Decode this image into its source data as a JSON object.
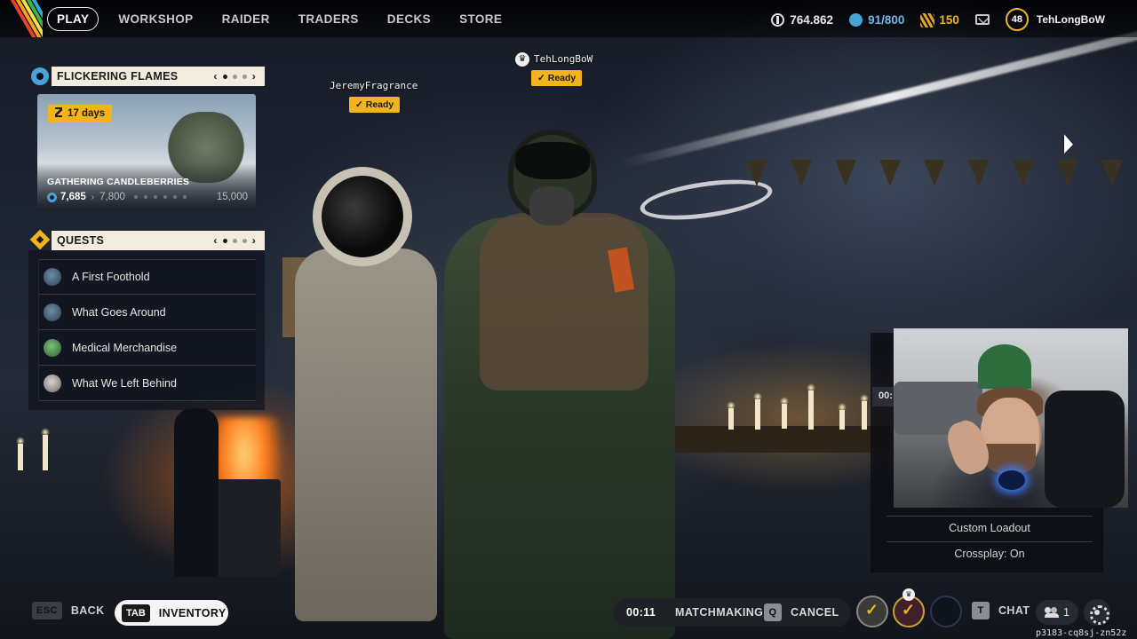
{
  "nav": {
    "items": [
      "PLAY",
      "WORKSHOP",
      "RAIDER",
      "TRADERS",
      "DECKS",
      "STORE"
    ]
  },
  "currencies": {
    "coins": "764.862",
    "stash": "91/800",
    "raider_tokens": "150",
    "level": "48",
    "username": "TehLongBoW"
  },
  "party": [
    {
      "name": "TehLongBoW",
      "status": "Ready",
      "leader": true
    },
    {
      "name": "JeremyFragrance",
      "status": "Ready",
      "leader": false
    }
  ],
  "event": {
    "header": "FLICKERING FLAMES",
    "days_left": "17  days",
    "title": "GATHERING CANDLEBERRIES",
    "current": "7,685",
    "next": "7,800",
    "max": "15,000"
  },
  "quests": {
    "header": "QUESTS",
    "items": [
      "A First Foothold",
      "What Goes Around",
      "Medical Merchandise",
      "What We Left Behind"
    ]
  },
  "right_panel": {
    "timer_peek": "00:",
    "custom_loadout": "Custom Loadout",
    "crossplay": "Crossplay: On"
  },
  "bottom": {
    "back_key": "ESC",
    "back_label": "BACK",
    "inventory_key": "TAB",
    "inventory_label": "INVENTORY",
    "matchmaking_time": "00:11",
    "matchmaking_label": "MATCHMAKING",
    "cancel_key": "Q",
    "cancel_label": "CANCEL",
    "chat_key": "T",
    "chat_label": "CHAT",
    "friends_count": "1"
  },
  "build_id": "p3183-cq8sj-zn52z",
  "colors": {
    "accent_yellow": "#f2b31b",
    "accent_blue": "#4aa3d8",
    "header_bg": "#f1ecdd"
  },
  "icons": [
    "coin-icon",
    "stash-icon",
    "raider-token-icon",
    "mail-icon",
    "gear-icon",
    "quest-icon",
    "hourglass-icon",
    "crown-icon",
    "check-icon",
    "people-icon",
    "settings-icon"
  ]
}
